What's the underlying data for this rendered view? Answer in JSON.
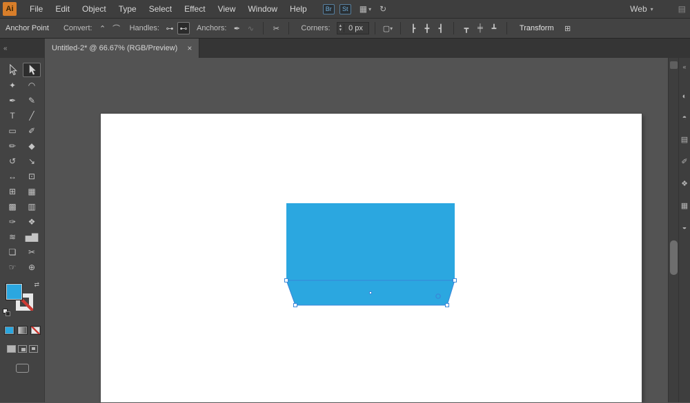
{
  "app": {
    "logo": "Ai",
    "workspace_label": "Web",
    "workspace_caret": "▾"
  },
  "menubar": {
    "items": [
      "File",
      "Edit",
      "Object",
      "Type",
      "Select",
      "Effect",
      "View",
      "Window",
      "Help"
    ],
    "br_badge": "Br",
    "st_badge": "St",
    "grid_icon_glyph": "▦",
    "arrange_caret": "▾",
    "sync_icon_glyph": "↻",
    "overflow_glyph": "▤"
  },
  "control_bar": {
    "context_label": "Anchor Point",
    "convert_label": "Convert:",
    "handles_label": "Handles:",
    "anchors_label": "Anchors:",
    "corners_label": "Corners:",
    "corners_value": "0 px",
    "transform_label": "Transform",
    "icons": {
      "convert_corner": "⌃",
      "convert_smooth": "⌒",
      "handles_mirror": "⊶",
      "handles_free": "⊷",
      "remove_anchor": "✒",
      "connect_endpoints": "∿",
      "cut_path": "✂",
      "stepper_up": "▴",
      "stepper_down": "▾",
      "select_similar": "▢",
      "select_similar_caret": "▾",
      "align_left": "┣",
      "align_center": "╋",
      "align_right": "┫",
      "valign_top": "┳",
      "valign_middle": "╪",
      "valign_bottom": "┻",
      "transform_options": "⊞"
    }
  },
  "document_tab": {
    "title": "Untitled-2* @ 66.67% (RGB/Preview)",
    "close_glyph": "×"
  },
  "toolbar": {
    "collapse_chevron": "«",
    "tools": [
      {
        "name": "selection",
        "glyph": ""
      },
      {
        "name": "direct-selection",
        "glyph": "",
        "active": true
      },
      {
        "name": "magic-wand",
        "glyph": "✦"
      },
      {
        "name": "lasso",
        "glyph": "◠"
      },
      {
        "name": "pen",
        "glyph": "✒"
      },
      {
        "name": "curvature",
        "glyph": "✎"
      },
      {
        "name": "type",
        "glyph": "T"
      },
      {
        "name": "line-segment",
        "glyph": "╱"
      },
      {
        "name": "rectangle",
        "glyph": "▭"
      },
      {
        "name": "paintbrush",
        "glyph": "✐"
      },
      {
        "name": "pencil",
        "glyph": "✏"
      },
      {
        "name": "eraser",
        "glyph": "◆"
      },
      {
        "name": "rotate",
        "glyph": "↺"
      },
      {
        "name": "scale",
        "glyph": "↘"
      },
      {
        "name": "width",
        "glyph": "↔"
      },
      {
        "name": "free-transform",
        "glyph": "⊡"
      },
      {
        "name": "shape-builder",
        "glyph": "⊞"
      },
      {
        "name": "perspective-grid",
        "glyph": "▦"
      },
      {
        "name": "mesh",
        "glyph": "▩"
      },
      {
        "name": "gradient",
        "glyph": "▥"
      },
      {
        "name": "eyedropper",
        "glyph": "✑"
      },
      {
        "name": "blend",
        "glyph": "❖"
      },
      {
        "name": "symbol-sprayer",
        "glyph": "≋"
      },
      {
        "name": "column-graph",
        "glyph": "▅▇"
      },
      {
        "name": "artboard",
        "glyph": "❏"
      },
      {
        "name": "slice",
        "glyph": "✂"
      },
      {
        "name": "hand",
        "glyph": "☞"
      },
      {
        "name": "zoom",
        "glyph": "⊕"
      }
    ],
    "swatches": {
      "fill_color": "#2BA7E0",
      "swap_glyph": "⇄"
    }
  },
  "canvas": {
    "artwork": {
      "fill_color": "#2BA7E0",
      "selection_color": "#3A86D8"
    }
  },
  "right_dock": {
    "expand_chevron": "«",
    "icons": [
      {
        "name": "color-panel",
        "glyph": "◐"
      },
      {
        "name": "color-guide-panel",
        "glyph": "◓"
      },
      {
        "name": "swatches-panel",
        "glyph": "▤"
      },
      {
        "name": "brushes-panel",
        "glyph": "✐"
      },
      {
        "name": "symbols-panel",
        "glyph": "❖"
      },
      {
        "name": "stroke-panel",
        "glyph": "▦"
      },
      {
        "name": "layers-panel",
        "glyph": "◒"
      }
    ]
  }
}
